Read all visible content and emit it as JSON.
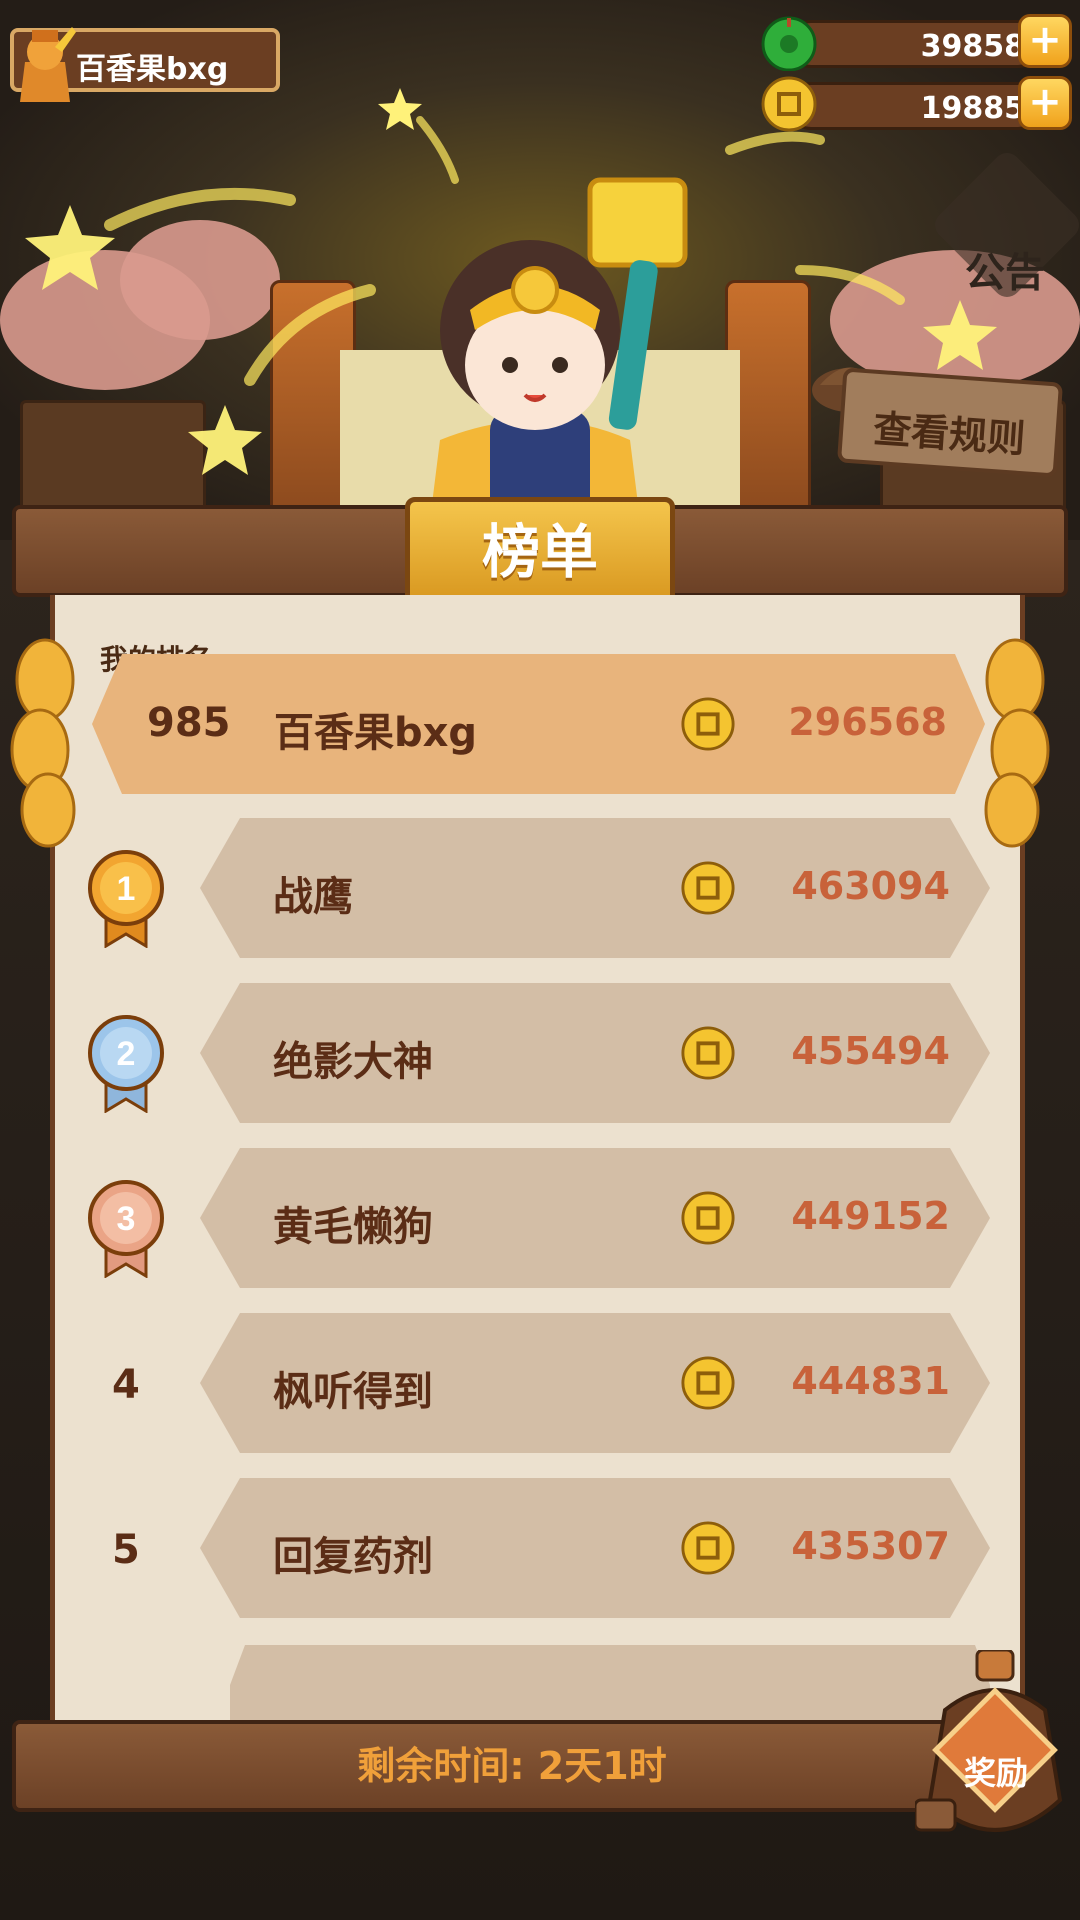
{
  "header": {
    "username": "百香果bxg",
    "currencies": [
      {
        "icon": "jade-icon",
        "value": "39858"
      },
      {
        "icon": "coin-icon",
        "value": "19885"
      }
    ],
    "notice_label": "公告",
    "rules_label": "查看规则"
  },
  "board": {
    "title": "榜单",
    "my_rank_label": "我的排名",
    "my_rank": {
      "rank": "985",
      "name": "百香果bxg",
      "score": "296568"
    },
    "rows": [
      {
        "rank": "1",
        "name": "战鹰",
        "score": "463094"
      },
      {
        "rank": "2",
        "name": "绝影大神",
        "score": "455494"
      },
      {
        "rank": "3",
        "name": "黄毛懒狗",
        "score": "449152"
      },
      {
        "rank": "4",
        "name": "枫听得到",
        "score": "444831"
      },
      {
        "rank": "5",
        "name": "回复药剂",
        "score": "435307"
      }
    ]
  },
  "footer": {
    "time_remaining": "剩余时间: 2天1时",
    "reward_label": "奖励"
  },
  "colors": {
    "accent_gold": "#f0a21c",
    "wood": "#6b3e22",
    "score_text": "#c8623a",
    "name_text": "#5b2d16",
    "my_row": "#e8b47c",
    "row_bg": "#d3bea6"
  }
}
